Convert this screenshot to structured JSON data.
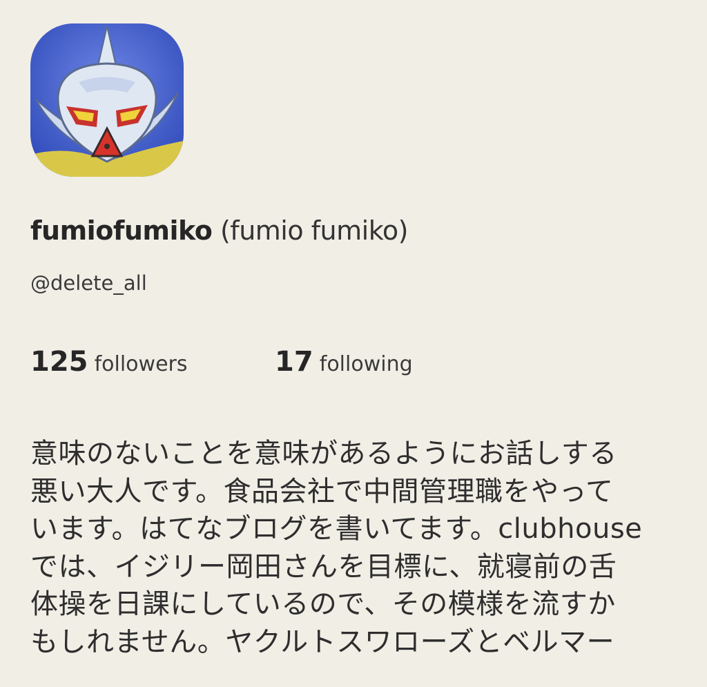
{
  "profile": {
    "display_name": "fumiofumiko",
    "full_name": "(fumio fumiko)",
    "handle": "@delete_all",
    "avatar_icon": "mascot-character-avatar"
  },
  "stats": {
    "followers_count": "125",
    "followers_label": "followers",
    "following_count": "17",
    "following_label": "following"
  },
  "bio": {
    "lines": [
      "意味のないことを意味があるようにお話しする",
      "悪い大人です。食品会社で中間管理職をやって",
      "います。はてなブログを書いてます。clubhouse",
      "では、イジリー岡田さんを目標に、就寝前の舌",
      "体操を日課にしているので、その模様を流すか",
      "もしれません。ヤクルトスワローズとベルマー"
    ]
  },
  "colors": {
    "background": "#f1eee6",
    "text_primary": "#262626",
    "avatar_sky": "#3f5fd0",
    "avatar_face": "#dfe7f3",
    "avatar_eye_red": "#c8322d",
    "avatar_eye_yellow": "#f0d23a",
    "avatar_ground": "#d9c848"
  }
}
